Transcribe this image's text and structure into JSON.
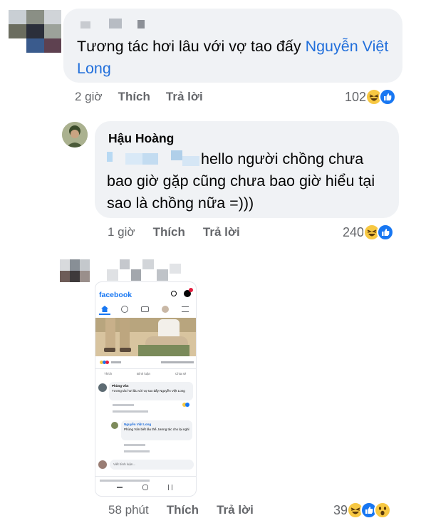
{
  "comments": [
    {
      "author": "",
      "text": "Tương tác hơi lâu với vợ tao đấy ",
      "mention": "Nguyễn Việt Long",
      "time": "2 giờ",
      "like_label": "Thích",
      "reply_label": "Trả lời",
      "reaction_count": "102",
      "reaction_icons": [
        "haha-icon",
        "like-icon"
      ]
    },
    {
      "author": "Hậu Hoàng",
      "text": "hello người chồng chưa bao giờ gặp cũng chưa bao giờ hiểu tại sao là chồng nữa =)))",
      "time": "1 giờ",
      "like_label": "Thích",
      "reply_label": "Trả lời",
      "reaction_count": "240",
      "reaction_icons": [
        "haha-icon",
        "like-icon"
      ]
    },
    {
      "author": "",
      "time": "58 phút",
      "like_label": "Thích",
      "reply_label": "Trả lời",
      "reaction_count": "39",
      "reaction_icons": [
        "haha-icon",
        "like-icon",
        "wow-icon"
      ]
    }
  ],
  "embedded_screenshot": {
    "logo": "facebook",
    "like_label": "Thích",
    "comment_label": "Bình luận",
    "share_label": "Chia sẻ",
    "comment1_author": "Phùng Vân",
    "comment1_text": "Tương tác hơi lâu với vợ tao đấy Nguyễn Việt Long",
    "comment2_author": "Nguyễn Việt Long",
    "comment2_text": "Phùng Vân biết lâu thế, tương tác cho lại nghỉ",
    "write_placeholder": "Viết bình luận...",
    "reaction_count": "2"
  },
  "colors": {
    "mention": "#216fdb",
    "bubble": "#f0f2f5",
    "meta_text": "#65676b",
    "like_blue": "#1877f2",
    "haha_yellow": "#f7c843"
  }
}
